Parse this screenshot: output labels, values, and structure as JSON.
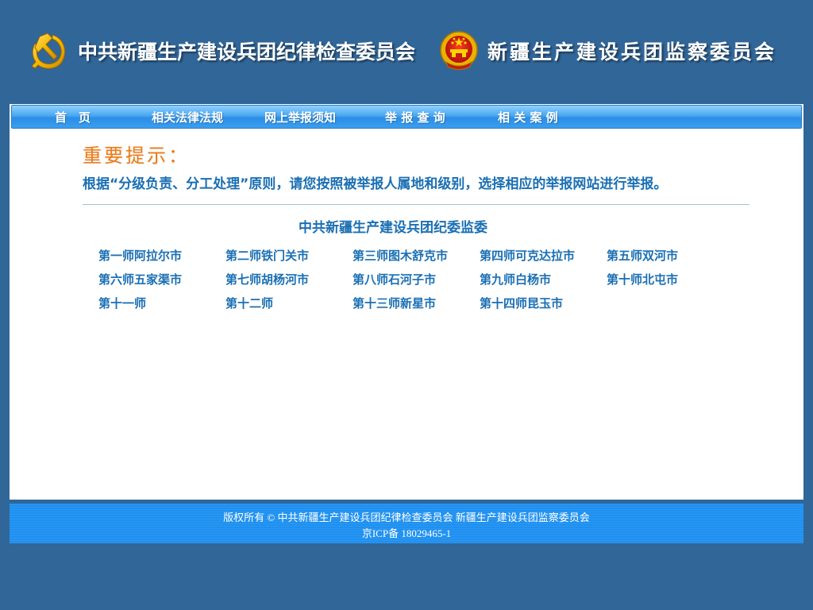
{
  "header": {
    "title_left": "中共新疆生产建设兵团纪律检查委员会",
    "title_right": "新疆生产建设兵团监察委员会",
    "emblem_left_icon": "party-emblem-icon",
    "emblem_right_icon": "national-emblem-icon"
  },
  "nav": {
    "items": [
      {
        "label": "首　页"
      },
      {
        "label": "相关法律法规"
      },
      {
        "label": "网上举报须知"
      },
      {
        "label": "举 报 查 询"
      },
      {
        "label": "相 关 案 例"
      }
    ]
  },
  "notice": {
    "title": "重要提示：",
    "text": "根据“分级负责、分工处理”原则，请您按照被举报人属地和级别，选择相应的举报网站进行举报。"
  },
  "section": {
    "title": "中共新疆生产建设兵团纪委监委",
    "links": [
      "第一师阿拉尔市",
      "第二师铁门关市",
      "第三师图木舒克市",
      "第四师可克达拉市",
      "第五师双河市",
      "第六师五家渠市",
      "第七师胡杨河市",
      "第八师石河子市",
      "第九师白杨市",
      "第十师北屯市",
      "第十一师",
      "第十二师",
      "第十三师新星市",
      "第十四师昆玉市"
    ]
  },
  "footer": {
    "copyright": "版权所有 © 中共新疆生产建设兵团纪律检查委员会 新疆生产建设兵团监察委员会",
    "icp": "京ICP备 18029465-1"
  },
  "colors": {
    "background": "#316699",
    "link": "#1a6fb3",
    "notice_title": "#f07a12",
    "footer": "#1e90f0"
  }
}
